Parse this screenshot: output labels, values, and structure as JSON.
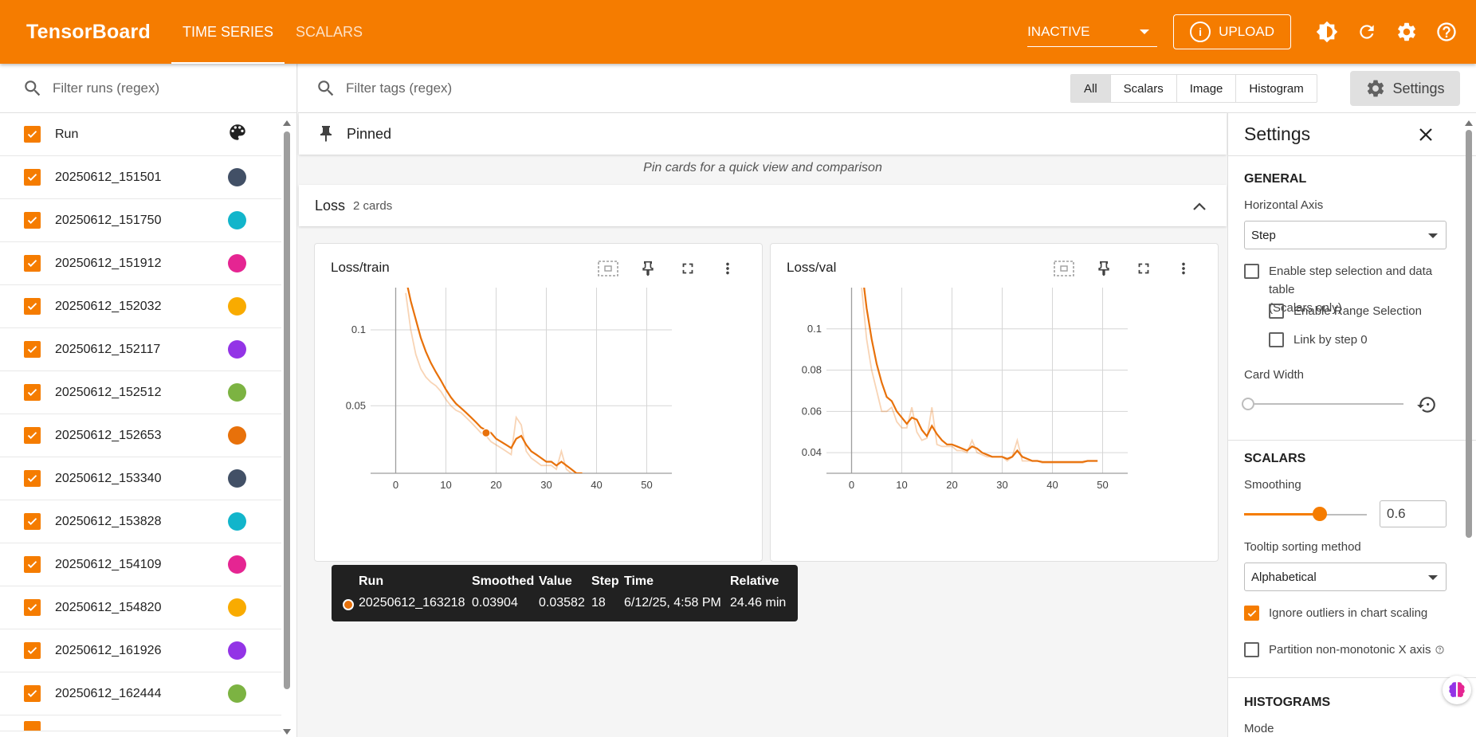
{
  "app": {
    "title": "TensorBoard"
  },
  "nav": {
    "tabs": [
      {
        "label": "TIME SERIES"
      },
      {
        "label": "SCALARS"
      }
    ]
  },
  "topbar": {
    "status_select": "INACTIVE",
    "upload_label": "UPLOAD"
  },
  "runs": {
    "filter_placeholder": "Filter runs (regex)",
    "header": "Run",
    "items": [
      {
        "name": "20250612_151501",
        "color": "#425066"
      },
      {
        "name": "20250612_151750",
        "color": "#12b5cb"
      },
      {
        "name": "20250612_151912",
        "color": "#e52592"
      },
      {
        "name": "20250612_152032",
        "color": "#f9ab00"
      },
      {
        "name": "20250612_152117",
        "color": "#9334e6"
      },
      {
        "name": "20250612_152512",
        "color": "#7cb342"
      },
      {
        "name": "20250612_152653",
        "color": "#e8710a"
      },
      {
        "name": "20250612_153340",
        "color": "#425066"
      },
      {
        "name": "20250612_153828",
        "color": "#12b5cb"
      },
      {
        "name": "20250612_154109",
        "color": "#e52592"
      },
      {
        "name": "20250612_154820",
        "color": "#f9ab00"
      },
      {
        "name": "20250612_161926",
        "color": "#9334e6"
      },
      {
        "name": "20250612_162444",
        "color": "#7cb342"
      }
    ]
  },
  "tags": {
    "filter_placeholder": "Filter tags (regex)",
    "filters": [
      "All",
      "Scalars",
      "Image",
      "Histogram"
    ],
    "active_filter": "All",
    "settings_button": "Settings"
  },
  "pinned": {
    "title": "Pinned",
    "empty_text": "Pin cards for a quick view and comparison"
  },
  "group": {
    "title": "Loss",
    "count": "2 cards"
  },
  "chart_data": [
    {
      "type": "line",
      "title": "Loss/train",
      "xlim": [
        -5,
        55
      ],
      "xticks": [
        "0",
        "10",
        "20",
        "30",
        "40",
        "50"
      ],
      "ylim": [
        0.027,
        0.147
      ],
      "yticks": [
        "0.05",
        "0.1"
      ],
      "yscale": "log",
      "grid": true,
      "series": [
        {
          "color": "#e8710a",
          "x": [
            2,
            3,
            4,
            5,
            6,
            7,
            8,
            9,
            10,
            11,
            12,
            13,
            14,
            15,
            16,
            17,
            18,
            19,
            20,
            21,
            22,
            23,
            24,
            25,
            26,
            27,
            28,
            29,
            30,
            31,
            32,
            33,
            34,
            35,
            36,
            37,
            38,
            39,
            40,
            41,
            42,
            43,
            44,
            45,
            46,
            47,
            48,
            49
          ],
          "smoothed": [
            0.16,
            0.13,
            0.11,
            0.093,
            0.082,
            0.074,
            0.068,
            0.063,
            0.058,
            0.054,
            0.051,
            0.049,
            0.047,
            0.045,
            0.043,
            0.041,
            0.04,
            0.039,
            0.037,
            0.036,
            0.035,
            0.034,
            0.037,
            0.038,
            0.035,
            0.033,
            0.032,
            0.031,
            0.03,
            0.03,
            0.029,
            0.03,
            0.029,
            0.028,
            0.027,
            0.027,
            0.026,
            0.026,
            0.025,
            0.025,
            0.024,
            0.024,
            0.024,
            0.0235,
            0.0235,
            0.023,
            0.023,
            0.023
          ],
          "raw": [
            0.14,
            0.1,
            0.08,
            0.07,
            0.065,
            0.062,
            0.06,
            0.057,
            0.053,
            0.05,
            0.048,
            0.047,
            0.045,
            0.043,
            0.041,
            0.039,
            0.038,
            0.036,
            0.035,
            0.034,
            0.033,
            0.032,
            0.045,
            0.042,
            0.033,
            0.031,
            0.03,
            0.029,
            0.029,
            0.029,
            0.028,
            0.033,
            0.028,
            0.027,
            0.026,
            0.026,
            0.025,
            0.025,
            0.025,
            0.024,
            0.024,
            0.024,
            0.024,
            0.023,
            0.023,
            0.023,
            0.023,
            0.023
          ]
        }
      ],
      "highlight": {
        "x": 18,
        "y": 0.03904
      }
    },
    {
      "type": "line",
      "title": "Loss/val",
      "xlim": [
        -5,
        55
      ],
      "xticks": [
        "0",
        "10",
        "20",
        "30",
        "40",
        "50"
      ],
      "ylim": [
        0.03,
        0.12
      ],
      "yticks": [
        "0.04",
        "0.06",
        "0.08",
        "0.1"
      ],
      "grid": true,
      "series": [
        {
          "color": "#e8710a",
          "x": [
            2,
            3,
            4,
            5,
            6,
            7,
            8,
            9,
            10,
            11,
            12,
            13,
            14,
            15,
            16,
            17,
            18,
            19,
            20,
            21,
            22,
            23,
            24,
            25,
            26,
            27,
            28,
            29,
            30,
            31,
            32,
            33,
            34,
            35,
            36,
            37,
            38,
            39,
            40,
            41,
            42,
            43,
            44,
            45,
            46,
            47,
            48,
            49
          ],
          "smoothed": [
            0.13,
            0.11,
            0.095,
            0.083,
            0.074,
            0.067,
            0.065,
            0.06,
            0.057,
            0.054,
            0.057,
            0.056,
            0.051,
            0.048,
            0.053,
            0.049,
            0.046,
            0.044,
            0.044,
            0.043,
            0.042,
            0.041,
            0.043,
            0.042,
            0.04,
            0.039,
            0.038,
            0.038,
            0.038,
            0.037,
            0.038,
            0.041,
            0.038,
            0.037,
            0.036,
            0.036,
            0.0355,
            0.0355,
            0.0355,
            0.0355,
            0.0355,
            0.0355,
            0.0355,
            0.0355,
            0.0355,
            0.036,
            0.036,
            0.036
          ],
          "raw": [
            0.12,
            0.095,
            0.08,
            0.07,
            0.06,
            0.06,
            0.062,
            0.055,
            0.052,
            0.052,
            0.062,
            0.05,
            0.046,
            0.047,
            0.062,
            0.044,
            0.043,
            0.043,
            0.043,
            0.041,
            0.041,
            0.04,
            0.046,
            0.04,
            0.039,
            0.038,
            0.038,
            0.038,
            0.038,
            0.036,
            0.038,
            0.046,
            0.036,
            0.036,
            0.036,
            0.036,
            0.035,
            0.035,
            0.035,
            0.035,
            0.035,
            0.035,
            0.035,
            0.035,
            0.035,
            0.036,
            0.036,
            0.036
          ]
        }
      ]
    }
  ],
  "tooltip": {
    "headers": {
      "run": "Run",
      "smoothed": "Smoothed",
      "value": "Value",
      "step": "Step",
      "time": "Time",
      "relative": "Relative"
    },
    "row": {
      "run": "20250612_163218",
      "smoothed": "0.03904",
      "value": "0.03582",
      "step": "18",
      "time": "6/12/25, 4:58 PM",
      "relative": "24.46 min",
      "color": "#e8710a"
    }
  },
  "settings": {
    "title": "Settings",
    "general_title": "GENERAL",
    "horizontal_axis_label": "Horizontal Axis",
    "horizontal_axis_value": "Step",
    "enable_step_selection": "Enable step selection and data table",
    "scalars_only": "(Scalars only)",
    "enable_range_selection": "Enable Range Selection",
    "link_by_step": "Link by step 0",
    "card_width_label": "Card Width",
    "scalars_title": "SCALARS",
    "smoothing_label": "Smoothing",
    "smoothing_value": "0.6",
    "tooltip_sort_label": "Tooltip sorting method",
    "tooltip_sort_value": "Alphabetical",
    "ignore_outliers": "Ignore outliers in chart scaling",
    "partition_non_monotonic": "Partition non-monotonic X axis",
    "histograms_title": "HISTOGRAMS",
    "mode_label": "Mode"
  },
  "colors": {
    "accent": "#f57c00",
    "line": "#e8710a"
  }
}
